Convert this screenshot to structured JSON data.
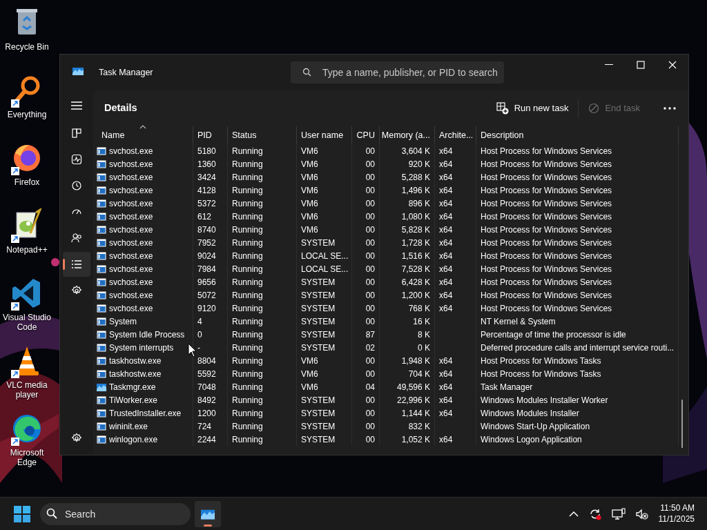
{
  "desktop_icons": [
    {
      "label": "Recycle Bin",
      "kind": "bin",
      "shortcut": false
    },
    {
      "label": "Everything",
      "kind": "everything",
      "shortcut": true
    },
    {
      "label": "Firefox",
      "kind": "firefox",
      "shortcut": true
    },
    {
      "label": "Notepad++",
      "kind": "notepad",
      "shortcut": true
    },
    {
      "label": "Visual Studio Code",
      "kind": "vscode",
      "shortcut": true
    },
    {
      "label": "VLC media player",
      "kind": "vlc",
      "shortcut": true
    },
    {
      "label": "Microsoft Edge",
      "kind": "edge",
      "shortcut": true
    }
  ],
  "window": {
    "title": "Task Manager",
    "search": {
      "placeholder": "Type a name, publisher, or PID to search"
    }
  },
  "nav": [
    {
      "kind": "processes",
      "selected": false
    },
    {
      "kind": "performance",
      "selected": false
    },
    {
      "kind": "history",
      "selected": false
    },
    {
      "kind": "startup",
      "selected": false
    },
    {
      "kind": "users",
      "selected": false
    },
    {
      "kind": "details",
      "selected": true
    },
    {
      "kind": "services",
      "selected": false
    }
  ],
  "page": {
    "title": "Details",
    "toolbar": [
      {
        "kind": "run",
        "label": "Run new task",
        "disabled": false
      },
      {
        "kind": "end",
        "label": "End task",
        "disabled": true
      }
    ]
  },
  "table": {
    "columns": [
      {
        "label": "Name",
        "sorted": true,
        "kind": "text"
      },
      {
        "label": "PID",
        "sorted": false,
        "kind": "text"
      },
      {
        "label": "Status",
        "sorted": false,
        "kind": "text"
      },
      {
        "label": "User name",
        "sorted": false,
        "kind": "text"
      },
      {
        "label": "CPU",
        "sorted": false,
        "kind": "number"
      },
      {
        "label": "Memory (a...",
        "sorted": false,
        "kind": "number"
      },
      {
        "label": "Archite...",
        "sorted": false,
        "kind": "text"
      },
      {
        "label": "Description",
        "sorted": false,
        "kind": "text"
      }
    ],
    "rows": [
      {
        "kind": "app",
        "cells": [
          "svchost.exe",
          "5180",
          "Running",
          "VM6",
          "00",
          "3,604 K",
          "x64",
          "Host Process for Windows Services"
        ]
      },
      {
        "kind": "app",
        "cells": [
          "svchost.exe",
          "1360",
          "Running",
          "VM6",
          "00",
          "920 K",
          "x64",
          "Host Process for Windows Services"
        ]
      },
      {
        "kind": "app",
        "cells": [
          "svchost.exe",
          "3424",
          "Running",
          "VM6",
          "00",
          "5,288 K",
          "x64",
          "Host Process for Windows Services"
        ]
      },
      {
        "kind": "app",
        "cells": [
          "svchost.exe",
          "4128",
          "Running",
          "VM6",
          "00",
          "1,496 K",
          "x64",
          "Host Process for Windows Services"
        ]
      },
      {
        "kind": "app",
        "cells": [
          "svchost.exe",
          "5372",
          "Running",
          "VM6",
          "00",
          "896 K",
          "x64",
          "Host Process for Windows Services"
        ]
      },
      {
        "kind": "app",
        "cells": [
          "svchost.exe",
          "612",
          "Running",
          "VM6",
          "00",
          "1,080 K",
          "x64",
          "Host Process for Windows Services"
        ]
      },
      {
        "kind": "app",
        "cells": [
          "svchost.exe",
          "8740",
          "Running",
          "VM6",
          "00",
          "5,828 K",
          "x64",
          "Host Process for Windows Services"
        ]
      },
      {
        "kind": "app",
        "cells": [
          "svchost.exe",
          "7952",
          "Running",
          "SYSTEM",
          "00",
          "1,728 K",
          "x64",
          "Host Process for Windows Services"
        ]
      },
      {
        "kind": "app",
        "cells": [
          "svchost.exe",
          "9024",
          "Running",
          "LOCAL SE...",
          "00",
          "1,516 K",
          "x64",
          "Host Process for Windows Services"
        ]
      },
      {
        "kind": "app",
        "cells": [
          "svchost.exe",
          "7984",
          "Running",
          "LOCAL SE...",
          "00",
          "7,528 K",
          "x64",
          "Host Process for Windows Services"
        ]
      },
      {
        "kind": "app",
        "cells": [
          "svchost.exe",
          "9656",
          "Running",
          "SYSTEM",
          "00",
          "6,428 K",
          "x64",
          "Host Process for Windows Services"
        ]
      },
      {
        "kind": "app",
        "cells": [
          "svchost.exe",
          "5072",
          "Running",
          "SYSTEM",
          "00",
          "1,200 K",
          "x64",
          "Host Process for Windows Services"
        ]
      },
      {
        "kind": "app",
        "cells": [
          "svchost.exe",
          "9120",
          "Running",
          "SYSTEM",
          "00",
          "768 K",
          "x64",
          "Host Process for Windows Services"
        ]
      },
      {
        "kind": "app",
        "cells": [
          "System",
          "4",
          "Running",
          "SYSTEM",
          "00",
          "16 K",
          "",
          "NT Kernel & System"
        ]
      },
      {
        "kind": "app",
        "cells": [
          "System Idle Process",
          "0",
          "Running",
          "SYSTEM",
          "87",
          "8 K",
          "",
          "Percentage of time the processor is idle"
        ]
      },
      {
        "kind": "app",
        "cells": [
          "System interrupts",
          "-",
          "Running",
          "SYSTEM",
          "02",
          "0 K",
          "",
          "Deferred procedure calls and interrupt service routi..."
        ]
      },
      {
        "kind": "app",
        "cells": [
          "taskhostw.exe",
          "8804",
          "Running",
          "VM6",
          "00",
          "1,948 K",
          "x64",
          "Host Process for Windows Tasks"
        ]
      },
      {
        "kind": "app",
        "cells": [
          "taskhostw.exe",
          "5592",
          "Running",
          "VM6",
          "00",
          "704 K",
          "x64",
          "Host Process for Windows Tasks"
        ]
      },
      {
        "kind": "taskmgr",
        "cells": [
          "Taskmgr.exe",
          "7048",
          "Running",
          "VM6",
          "04",
          "49,596 K",
          "x64",
          "Task Manager"
        ]
      },
      {
        "kind": "app",
        "cells": [
          "TiWorker.exe",
          "8492",
          "Running",
          "SYSTEM",
          "00",
          "22,996 K",
          "x64",
          "Windows Modules Installer Worker"
        ]
      },
      {
        "kind": "app",
        "cells": [
          "TrustedInstaller.exe",
          "1200",
          "Running",
          "SYSTEM",
          "00",
          "1,144 K",
          "x64",
          "Windows Modules Installer"
        ]
      },
      {
        "kind": "app",
        "cells": [
          "wininit.exe",
          "724",
          "Running",
          "SYSTEM",
          "00",
          "832 K",
          "",
          "Windows Start-Up Application"
        ]
      },
      {
        "kind": "app",
        "cells": [
          "winlogon.exe",
          "2244",
          "Running",
          "SYSTEM",
          "00",
          "1,052 K",
          "x64",
          "Windows Logon Application"
        ]
      }
    ]
  },
  "taskbar": {
    "search": {
      "placeholder": "Search"
    },
    "apps": [
      {
        "kind": "taskmgr",
        "selected": true
      }
    ],
    "time": "11:50 AM",
    "date": "11/1/2025"
  }
}
